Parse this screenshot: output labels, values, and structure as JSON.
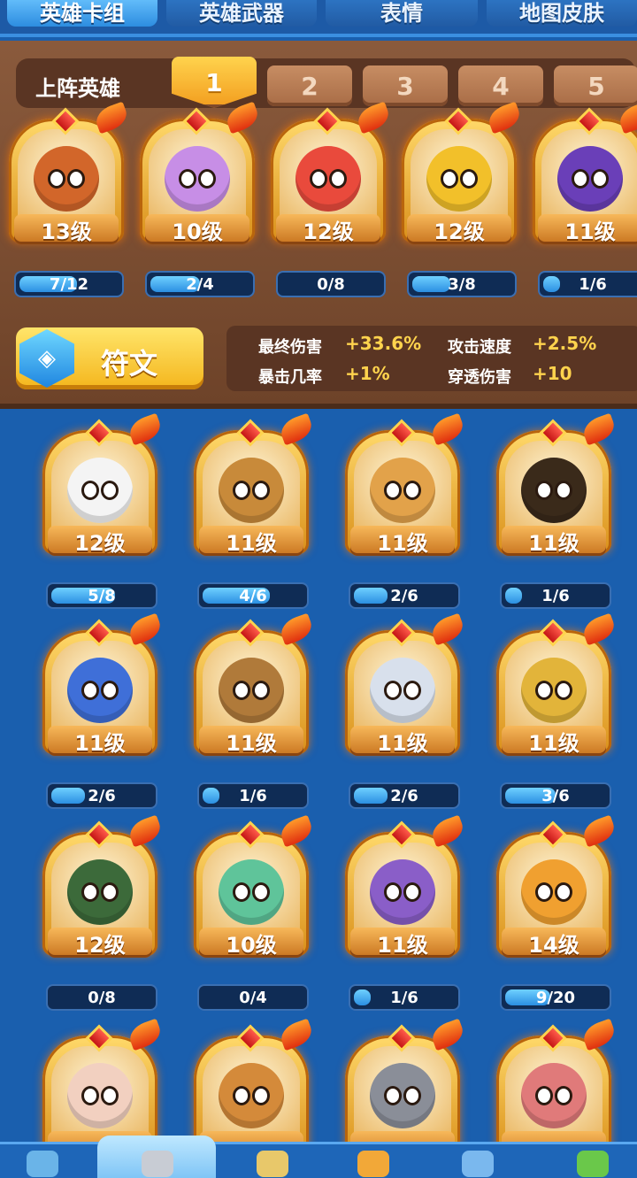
{
  "tabs": [
    {
      "label": "英雄卡组",
      "active": true
    },
    {
      "label": "英雄武器",
      "active": false
    },
    {
      "label": "表情",
      "active": false
    },
    {
      "label": "地图皮肤",
      "active": false
    }
  ],
  "team": {
    "label": "上阵英雄",
    "slots": [
      "1",
      "2",
      "3",
      "4",
      "5"
    ],
    "active_slot": "1",
    "heroes": [
      {
        "level": "13级",
        "progress": "7/12",
        "fill": 0.58,
        "color": "#d2662a"
      },
      {
        "level": "10级",
        "progress": "2/4",
        "fill": 0.5,
        "color": "#c78ee6"
      },
      {
        "level": "12级",
        "progress": "0/8",
        "fill": 0.0,
        "color": "#e94a3c"
      },
      {
        "level": "12级",
        "progress": "3/8",
        "fill": 0.38,
        "color": "#f2c02a"
      },
      {
        "level": "11级",
        "progress": "1/6",
        "fill": 0.17,
        "color": "#6a3fb8"
      }
    ]
  },
  "rune": {
    "label": "符文",
    "icon": "rune-gem-icon"
  },
  "stats": [
    {
      "name": "最终伤害",
      "value": "+33.6%"
    },
    {
      "name": "攻击速度",
      "value": "+2.5%"
    },
    {
      "name": "暴击几率",
      "value": "+1%"
    },
    {
      "name": "穿透伤害",
      "value": "+10"
    }
  ],
  "collection": [
    {
      "level": "12级",
      "progress": "5/8",
      "fill": 0.63,
      "color": "#f4f4f4"
    },
    {
      "level": "11级",
      "progress": "4/6",
      "fill": 0.67,
      "color": "#c88a3a"
    },
    {
      "level": "11级",
      "progress": "2/6",
      "fill": 0.33,
      "color": "#e2a24a"
    },
    {
      "level": "11级",
      "progress": "1/6",
      "fill": 0.17,
      "color": "#3a2a1a"
    },
    {
      "level": "11级",
      "progress": "2/6",
      "fill": 0.33,
      "color": "#3f6fd8"
    },
    {
      "level": "11级",
      "progress": "1/6",
      "fill": 0.17,
      "color": "#b07a3a"
    },
    {
      "level": "11级",
      "progress": "2/6",
      "fill": 0.33,
      "color": "#d8e0ec"
    },
    {
      "level": "11级",
      "progress": "3/6",
      "fill": 0.5,
      "color": "#e2b43a"
    },
    {
      "level": "12级",
      "progress": "0/8",
      "fill": 0.0,
      "color": "#3c6a3a"
    },
    {
      "level": "10级",
      "progress": "0/4",
      "fill": 0.0,
      "color": "#5fc49a"
    },
    {
      "level": "11级",
      "progress": "1/6",
      "fill": 0.17,
      "color": "#8a5ec8"
    },
    {
      "level": "14级",
      "progress": "9/20",
      "fill": 0.45,
      "color": "#f0a030"
    },
    {
      "level": "",
      "progress": "",
      "fill": 0.0,
      "color": "#f2d0c0"
    },
    {
      "level": "",
      "progress": "",
      "fill": 0.0,
      "color": "#d48a3a"
    },
    {
      "level": "",
      "progress": "",
      "fill": 0.0,
      "color": "#8a8e98"
    },
    {
      "level": "",
      "progress": "",
      "fill": 0.0,
      "color": "#e07a7a"
    }
  ],
  "bottom_nav": [
    {
      "icon": "shop-icon",
      "color": "#6ab4e8"
    },
    {
      "icon": "knight-helmet-icon",
      "color": "#c8ccd4"
    },
    {
      "icon": "crossed-swords-icon",
      "color": "#e8c86a"
    },
    {
      "icon": "crown-icon",
      "color": "#f2a838"
    },
    {
      "icon": "team-icon",
      "color": "#7ab8ee"
    },
    {
      "icon": "sprout-icon",
      "color": "#6ac84a"
    }
  ]
}
